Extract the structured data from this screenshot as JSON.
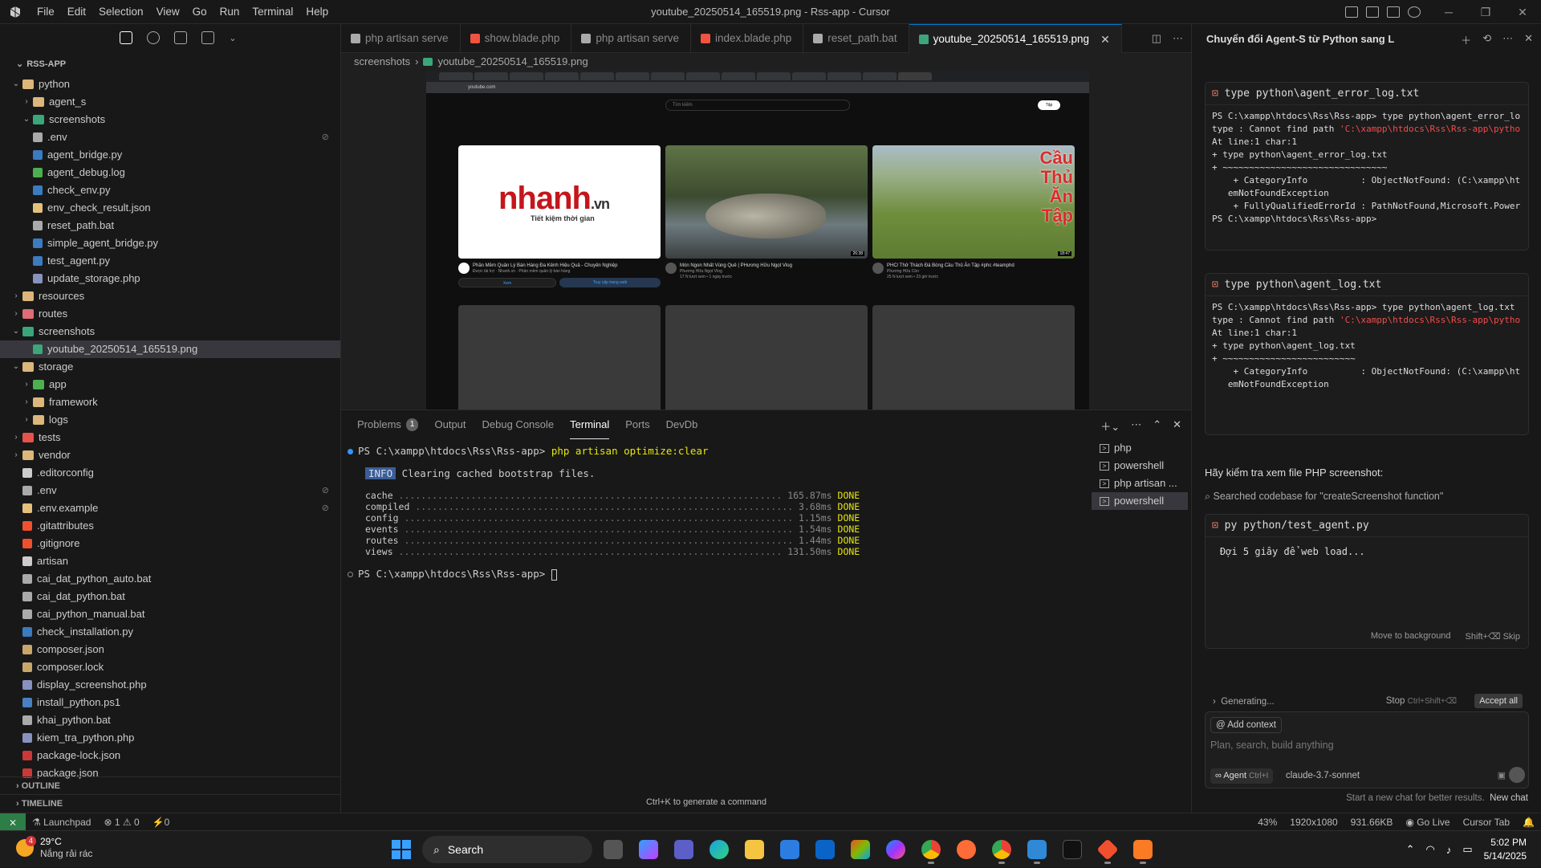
{
  "titlebar": {
    "menu": [
      "File",
      "Edit",
      "Selection",
      "View",
      "Go",
      "Run",
      "Terminal",
      "Help"
    ],
    "title": "youtube_20250514_165519.png - Rss-app - Cursor"
  },
  "explorer": {
    "root": "RSS-APP",
    "outline": "OUTLINE",
    "timeline": "TIMELINE",
    "items": [
      {
        "label": "python",
        "depth": 0,
        "type": "folder",
        "open": true
      },
      {
        "label": "agent_s",
        "depth": 1,
        "type": "folder",
        "open": false
      },
      {
        "label": "screenshots",
        "depth": 1,
        "type": "folder-img",
        "open": true
      },
      {
        "label": ".env",
        "depth": 1,
        "type": "gear",
        "badge": "⊘"
      },
      {
        "label": "agent_bridge.py",
        "depth": 1,
        "type": "py"
      },
      {
        "label": "agent_debug.log",
        "depth": 1,
        "type": "log"
      },
      {
        "label": "check_env.py",
        "depth": 1,
        "type": "py"
      },
      {
        "label": "env_check_result.json",
        "depth": 1,
        "type": "json"
      },
      {
        "label": "reset_path.bat",
        "depth": 1,
        "type": "bat"
      },
      {
        "label": "simple_agent_bridge.py",
        "depth": 1,
        "type": "py"
      },
      {
        "label": "test_agent.py",
        "depth": 1,
        "type": "py"
      },
      {
        "label": "update_storage.php",
        "depth": 1,
        "type": "php"
      },
      {
        "label": "resources",
        "depth": 0,
        "type": "folder",
        "open": false
      },
      {
        "label": "routes",
        "depth": 0,
        "type": "folder-r",
        "open": false
      },
      {
        "label": "screenshots",
        "depth": 0,
        "type": "folder-img",
        "open": true
      },
      {
        "label": "youtube_20250514_165519.png",
        "depth": 1,
        "type": "img",
        "selected": true
      },
      {
        "label": "storage",
        "depth": 0,
        "type": "folder",
        "open": true
      },
      {
        "label": "app",
        "depth": 1,
        "type": "folder-g",
        "open": false
      },
      {
        "label": "framework",
        "depth": 1,
        "type": "folder",
        "open": false
      },
      {
        "label": "logs",
        "depth": 1,
        "type": "folder",
        "open": false
      },
      {
        "label": "tests",
        "depth": 0,
        "type": "folder-t",
        "open": false
      },
      {
        "label": "vendor",
        "depth": 0,
        "type": "folder",
        "open": false
      },
      {
        "label": ".editorconfig",
        "depth": 0,
        "type": "edit"
      },
      {
        "label": ".env",
        "depth": 0,
        "type": "gear",
        "badge": "⊘"
      },
      {
        "label": ".env.example",
        "depth": 0,
        "type": "env",
        "badge": "⊘"
      },
      {
        "label": ".gitattributes",
        "depth": 0,
        "type": "git"
      },
      {
        "label": ".gitignore",
        "depth": 0,
        "type": "git"
      },
      {
        "label": "artisan",
        "depth": 0,
        "type": "file"
      },
      {
        "label": "cai_dat_python_auto.bat",
        "depth": 0,
        "type": "bat"
      },
      {
        "label": "cai_dat_python.bat",
        "depth": 0,
        "type": "bat"
      },
      {
        "label": "cai_python_manual.bat",
        "depth": 0,
        "type": "bat"
      },
      {
        "label": "check_installation.py",
        "depth": 0,
        "type": "py"
      },
      {
        "label": "composer.json",
        "depth": 0,
        "type": "composer"
      },
      {
        "label": "composer.lock",
        "depth": 0,
        "type": "composer"
      },
      {
        "label": "display_screenshot.php",
        "depth": 0,
        "type": "php"
      },
      {
        "label": "install_python.ps1",
        "depth": 0,
        "type": "ps"
      },
      {
        "label": "khai_python.bat",
        "depth": 0,
        "type": "bat"
      },
      {
        "label": "kiem_tra_python.php",
        "depth": 0,
        "type": "php"
      },
      {
        "label": "package-lock.json",
        "depth": 0,
        "type": "npm"
      },
      {
        "label": "package.json",
        "depth": 0,
        "type": "npm"
      }
    ]
  },
  "tabs": [
    {
      "label": "php artisan serve",
      "icon": "terminal",
      "active": false
    },
    {
      "label": "show.blade.php",
      "icon": "blade",
      "active": false
    },
    {
      "label": "php artisan serve",
      "icon": "terminal",
      "active": false
    },
    {
      "label": "index.blade.php",
      "icon": "blade",
      "active": false
    },
    {
      "label": "reset_path.bat",
      "icon": "bat",
      "active": false
    },
    {
      "label": "youtube_20250514_165519.png",
      "icon": "img",
      "active": true
    }
  ],
  "breadcrumb": [
    "screenshots",
    "youtube_20250514_165519.png"
  ],
  "preview": {
    "address": "youtube.com",
    "search_placeholder": "Tìm kiếm",
    "signin": "Tập",
    "videos": [
      {
        "title": "Phần Mềm Quản Lý Bán Hàng Đa Kênh Hiệu Quả - Chuyên Nghiệp",
        "channel": "Được tài trợ · Nhanh.vn · Phần mềm quản lý bán hàng",
        "btn1": "Xem",
        "btn2": "Truy cập trang web",
        "logo": "nhanh",
        "logo_tld": ".vn",
        "tagline": "Tiết kiệm thời gian"
      },
      {
        "title": "Món Ngon Nhất Vùng Quê | PHương Hữu Ngọt Vlog",
        "channel": "Phương Hữu Ngọt Vlog",
        "stats": "17 N lượt xem • 1 ngày trước",
        "duration": "26:38"
      },
      {
        "title": "PHC/ Thử Thách Đá Bóng Cầu Thủ Ăn Tập #phc #teamphd",
        "channel": "Phương Hữu Còn",
        "stats": "25 N lượt xem • 23 giờ trước",
        "overlay": "Cầu Thủ Ăn Tập",
        "duration": "18:47"
      }
    ]
  },
  "panel": {
    "tabs": [
      {
        "label": "Problems",
        "count": "1"
      },
      {
        "label": "Output"
      },
      {
        "label": "Debug Console"
      },
      {
        "label": "Terminal",
        "active": true
      },
      {
        "label": "Ports"
      },
      {
        "label": "DevDb"
      }
    ],
    "prompt1": "PS C:\\xampp\\htdocs\\Rss\\Rss-app> ",
    "cmd": "php artisan optimize:clear",
    "info_tag": "INFO",
    "info_msg": "Clearing cached bootstrap files.",
    "rows": [
      {
        "name": "cache",
        "time": "165.87ms",
        "status": "DONE"
      },
      {
        "name": "compiled",
        "time": "3.68ms",
        "status": "DONE"
      },
      {
        "name": "config",
        "time": "1.15ms",
        "status": "DONE"
      },
      {
        "name": "events",
        "time": "1.54ms",
        "status": "DONE"
      },
      {
        "name": "routes",
        "time": "1.44ms",
        "status": "DONE"
      },
      {
        "name": "views",
        "time": "131.50ms",
        "status": "DONE"
      }
    ],
    "prompt2": "PS C:\\xampp\\htdocs\\Rss\\Rss-app> ",
    "terminals": [
      "php",
      "powershell",
      "php artisan ...",
      "powershell"
    ],
    "hint": "Ctrl+K to generate a command"
  },
  "chat": {
    "title": "Chuyển đổi Agent-S từ Python sang L",
    "card1": {
      "header": "type python\\agent_error_log.txt",
      "lines": [
        "PS C:\\xampp\\htdocs\\Rss\\Rss-app> type python\\agent_error_lo",
        "type : Cannot find path 'C:\\xampp\\htdocs\\Rss\\Rss-app\\pytho",
        "At line:1 char:1",
        "+ type python\\agent_error_log.txt",
        "+ ~~~~~~~~~~~~~~~~~~~~~~~~~~~~~~~",
        "    + CategoryInfo          : ObjectNotFound: (C:\\xampp\\ht",
        "   emNotFoundException",
        "    + FullyQualifiedErrorId : PathNotFound,Microsoft.Power",
        "",
        "PS C:\\xampp\\htdocs\\Rss\\Rss-app>"
      ]
    },
    "card2": {
      "header": "type python\\agent_log.txt",
      "lines": [
        "PS C:\\xampp\\htdocs\\Rss\\Rss-app> type python\\agent_log.txt",
        "type : Cannot find path 'C:\\xampp\\htdocs\\Rss\\Rss-app\\pytho",
        "At line:1 char:1",
        "+ type python\\agent_log.txt",
        "+ ~~~~~~~~~~~~~~~~~~~~~~~~~",
        "    + CategoryInfo          : ObjectNotFound: (C:\\xampp\\ht",
        "",
        "   emNotFoundException"
      ]
    },
    "message": "Hãy kiểm tra xem file PHP screenshot:",
    "searched": "Searched codebase for \"createScreenshot function\"",
    "card3": {
      "header": "py python/test_agent.py",
      "body": "Đợi 5 giây để web load...",
      "move": "Move to background",
      "skip": "Shift+⌫ Skip"
    },
    "generating": "Generating...",
    "stop": "Stop",
    "stop_keys": "Ctrl+Shift+⌫",
    "accept_all": "Accept all",
    "add_context": "Add context",
    "placeholder": "Plan, search, build anything",
    "agent": "Agent",
    "agent_keys": "Ctrl+I",
    "model": "claude-3.7-sonnet",
    "footer": "Start a new chat for better results.",
    "new_chat": "New chat"
  },
  "statusbar": {
    "launchpad": "Launchpad",
    "errors": "⊗ 1 ⚠ 0",
    "ports": "⚡0",
    "zoom": "43%",
    "dims": "1920x1080",
    "size": "931.66KB",
    "golive": "Go Live",
    "cursortab": "Cursor Tab"
  },
  "taskbar": {
    "temp": "29°C",
    "weather": "Nắng rải rác",
    "weather_badge": "4",
    "search": "Search",
    "time": "5:02 PM",
    "date": "5/14/2025"
  }
}
